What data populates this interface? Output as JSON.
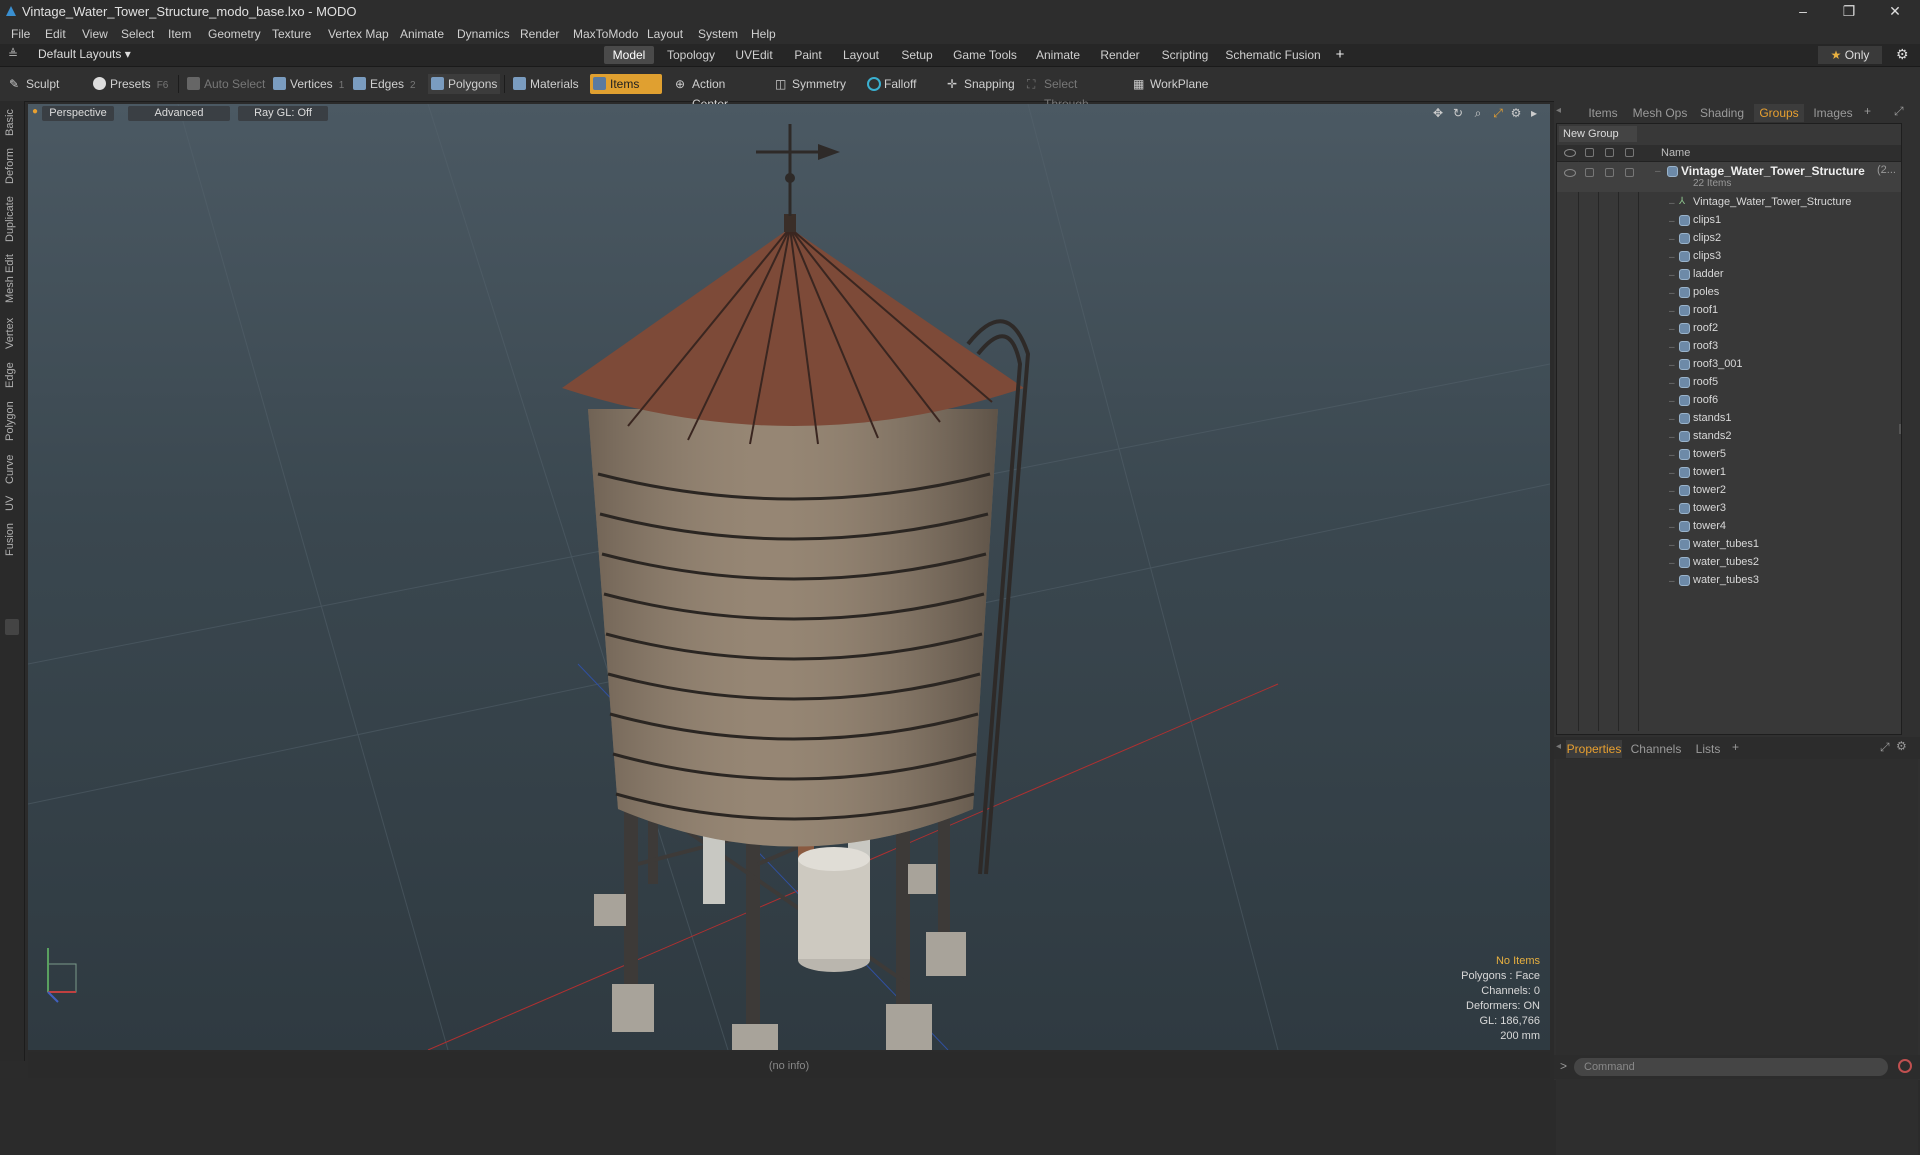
{
  "window": {
    "title": "Vintage_Water_Tower_Structure_modo_base.lxo - MODO",
    "controls": [
      "–",
      "❐",
      "✕"
    ]
  },
  "menu": [
    "File",
    "Edit",
    "View",
    "Select",
    "Item",
    "Geometry",
    "Texture",
    "Vertex Map",
    "Animate",
    "Dynamics",
    "Render",
    "MaxToModo",
    "Layout",
    "System",
    "Help"
  ],
  "layoutbar": {
    "layouts_label": "Default Layouts",
    "tabs": [
      "Model",
      "Topology",
      "UVEdit",
      "Paint",
      "Layout",
      "Setup",
      "Game Tools",
      "Animate",
      "Render",
      "Scripting",
      "Schematic Fusion"
    ],
    "active_tab": "Model",
    "add_label": "+",
    "only_label": "Only"
  },
  "toolbar": {
    "sculpt": "Sculpt",
    "presets": "Presets",
    "presets_key": "F6",
    "auto_select": "Auto Select",
    "vertices": "Vertices",
    "vertices_count": "1",
    "edges": "Edges",
    "edges_count": "2",
    "polygons": "Polygons",
    "materials": "Materials",
    "items": "Items",
    "action_center": "Action Center",
    "symmetry": "Symmetry",
    "falloff": "Falloff",
    "snapping": "Snapping",
    "select_through": "Select Through",
    "workplane": "WorkPlane"
  },
  "left_tabs": [
    "Basic",
    "Deform",
    "Duplicate",
    "Mesh Edit",
    "Vertex",
    "Edge",
    "Polygon",
    "Curve",
    "UV",
    "Fusion"
  ],
  "viewport": {
    "view_mode": "Perspective",
    "shading": "Advanced",
    "raygl": "Ray GL: Off",
    "info": {
      "items": "No Items",
      "polygons": "Polygons : Face",
      "channels": "Channels: 0",
      "deformers": "Deformers: ON",
      "gl": "GL: 186,766",
      "scale": "200 mm"
    }
  },
  "status": {
    "text": "(no info)"
  },
  "right_panel": {
    "tabs": [
      "Items",
      "Mesh Ops",
      "Shading",
      "Groups",
      "Images"
    ],
    "active_tab": "Groups",
    "new_group": "New Group",
    "name_col": "Name",
    "group": {
      "name": "Vintage_Water_Tower_Structure",
      "count_suffix": "(2...",
      "sub": "22 Items"
    },
    "items": [
      "Vintage_Water_Tower_Structure",
      "clips1",
      "clips2",
      "clips3",
      "ladder",
      "poles",
      "roof1",
      "roof2",
      "roof3",
      "roof3_001",
      "roof5",
      "roof6",
      "stands1",
      "stands2",
      "tower5",
      "tower1",
      "tower2",
      "tower3",
      "tower4",
      "water_tubes1",
      "water_tubes2",
      "water_tubes3"
    ],
    "bottom_tabs": [
      "Properties",
      "Channels",
      "Lists"
    ],
    "bottom_active": "Properties",
    "command_placeholder": "Command"
  },
  "colors": {
    "accent": "#e8a030",
    "items_active": "#e0a030",
    "viewport_top": "#4b5963",
    "viewport_bottom": "#2f3a41"
  }
}
